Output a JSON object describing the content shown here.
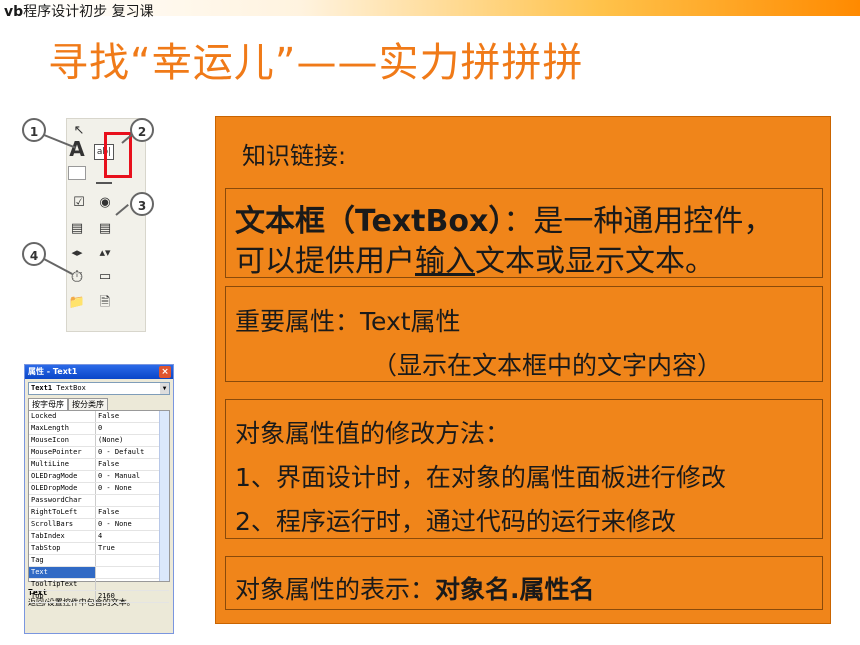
{
  "header": {
    "course_prefix": "vb",
    "course_rest": "程序设计初步 复习课",
    "title": "寻找“幸运儿”——实力拼拼拼"
  },
  "toolbox": {
    "callouts": [
      "1",
      "2",
      "3",
      "4"
    ],
    "textbox_icon_label": "ab|"
  },
  "properties_window": {
    "title": "属性 - Text1",
    "close_glyph": "×",
    "object_name": "Text1",
    "object_type": "TextBox",
    "tabs": [
      "按字母序",
      "按分类序"
    ],
    "rows": [
      {
        "name": "Locked",
        "value": "False"
      },
      {
        "name": "MaxLength",
        "value": "0"
      },
      {
        "name": "MouseIcon",
        "value": "(None)"
      },
      {
        "name": "MousePointer",
        "value": "0 - Default"
      },
      {
        "name": "MultiLine",
        "value": "False"
      },
      {
        "name": "OLEDragMode",
        "value": "0 - Manual"
      },
      {
        "name": "OLEDropMode",
        "value": "0 - None"
      },
      {
        "name": "PasswordChar",
        "value": ""
      },
      {
        "name": "RightToLeft",
        "value": "False"
      },
      {
        "name": "ScrollBars",
        "value": "0 - None"
      },
      {
        "name": "TabIndex",
        "value": "4"
      },
      {
        "name": "TabStop",
        "value": "True"
      },
      {
        "name": "Tag",
        "value": ""
      },
      {
        "name": "Text",
        "value": ""
      },
      {
        "name": "ToolTipText",
        "value": ""
      },
      {
        "name": "Top",
        "value": "2160"
      }
    ],
    "selected_row": "Text",
    "desc_name": "Text",
    "desc_text": "返回/设置控件中包含的文本。"
  },
  "panel": {
    "heading": "知识链接:",
    "textbox_term": "文本框（TextBox）",
    "textbox_def1": "：是一种通用控件，",
    "textbox_def2_a": "可以提供用户",
    "textbox_def2_u": "输入",
    "textbox_def2_b": "文本或显示文本。",
    "important_prop": "重要属性：Text属性",
    "important_note": "（显示在文本框中的文字内容）",
    "modify_heading": "对象属性值的修改方法：",
    "modify_1": "1、界面设计时，在对象的属性面板进行修改",
    "modify_2": "2、程序运行时，通过代码的运行来修改",
    "repr_label": "对象属性的表示：",
    "repr_value": "对象名.属性名"
  },
  "colors": {
    "title": "#f07a18",
    "panel": "#f0851a",
    "highlight": "#e8101c"
  }
}
